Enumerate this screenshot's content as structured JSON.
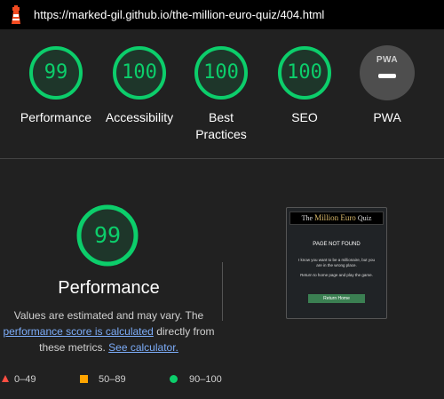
{
  "browser": {
    "url": "https://marked-gil.github.io/the-million-euro-quiz/404.html"
  },
  "summary": {
    "categories": [
      {
        "label": "Performance",
        "score": "99"
      },
      {
        "label": "Accessibility",
        "score": "100"
      },
      {
        "label": "Best Practices",
        "label_line1": "Best",
        "label_line2": "Practices",
        "score": "100"
      },
      {
        "label": "SEO",
        "score": "100"
      },
      {
        "label": "PWA",
        "badge": "PWA"
      }
    ],
    "pass_color": "#0cce6b"
  },
  "detail": {
    "score": "99",
    "title": "Performance",
    "desc_part1": "Values are estimated and may vary. The",
    "link_score": "performance score is calculated",
    "desc_part2": " directly from these metrics.",
    "link_calc": "See calculator."
  },
  "screenshot": {
    "header_left": "The ",
    "header_mid": "Million Euro",
    "header_right": " Quiz",
    "title": "PAGE NOT FOUND",
    "text1": "I know you want to be a millionaire, but you are in the wrong place.",
    "text2": "Return to home page and play the game.",
    "button": "Return Home"
  },
  "legend": {
    "fail": "0–49",
    "average": "50–89",
    "pass": "90–100"
  }
}
